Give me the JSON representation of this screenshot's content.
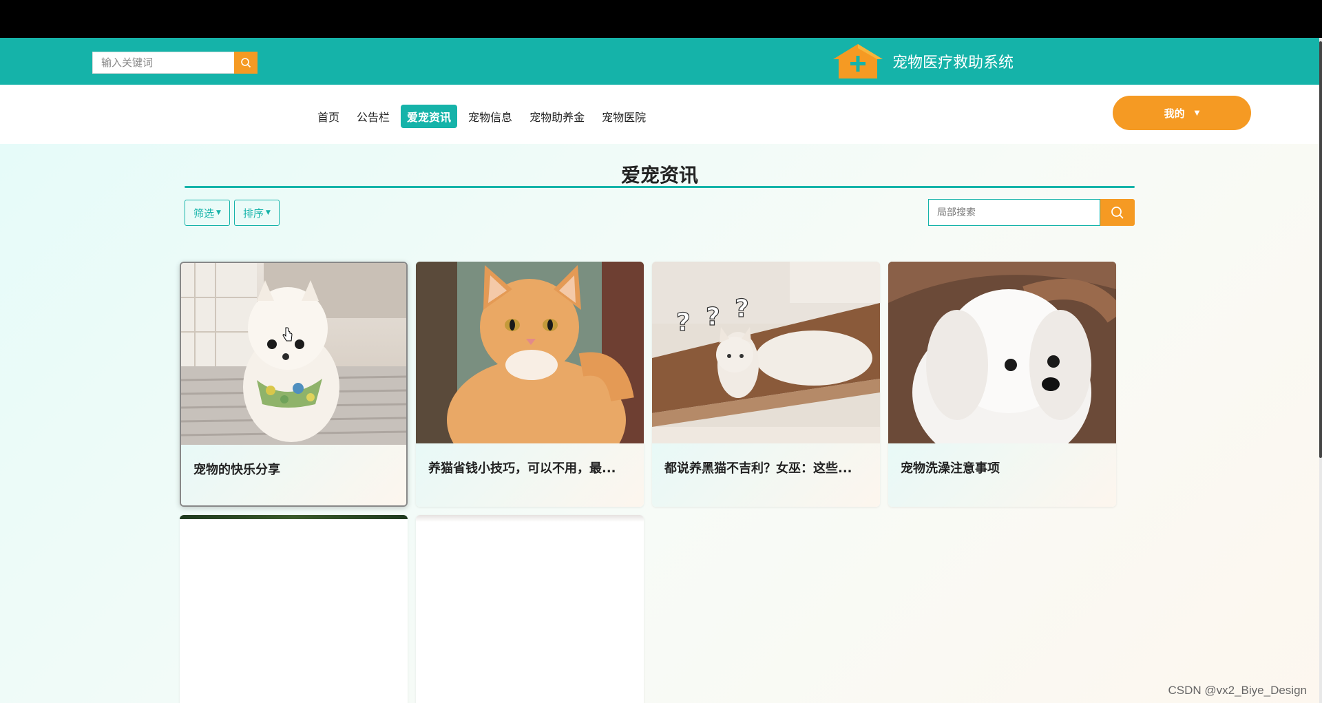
{
  "header": {
    "search_placeholder": "输入关键词",
    "title": "宠物医疗救助系统",
    "search_icon": "search-icon",
    "logo_icon": "house-plus-logo"
  },
  "nav": {
    "items": [
      {
        "label": "首页",
        "active": false
      },
      {
        "label": "公告栏",
        "active": false
      },
      {
        "label": "爱宠资讯",
        "active": true
      },
      {
        "label": "宠物信息",
        "active": false
      },
      {
        "label": "宠物助养金",
        "active": false
      },
      {
        "label": "宠物医院",
        "active": false
      }
    ],
    "user_menu_label": "我的"
  },
  "page": {
    "title": "爱宠资讯",
    "filter_label": "筛选",
    "sort_label": "排序",
    "local_search_placeholder": "局部搜索"
  },
  "cards": [
    {
      "title": "宠物的快乐分享",
      "image": "white pomeranian dog with floral bandana"
    },
    {
      "title": "养猫省钱小技巧，可以不用，最...",
      "image": "orange tabby kitten"
    },
    {
      "title": "都说养黑猫不吉利？女巫：这些...",
      "image": "white cat with question marks"
    },
    {
      "title": "宠物洗澡注意事项",
      "image": "white maltese puppy"
    },
    {
      "title": "",
      "image": "loading"
    },
    {
      "title": "",
      "image": "loading"
    }
  ],
  "watermark": "CSDN @vx2_Biye_Design",
  "colors": {
    "primary": "#15b3a9",
    "accent": "#f59a23"
  }
}
